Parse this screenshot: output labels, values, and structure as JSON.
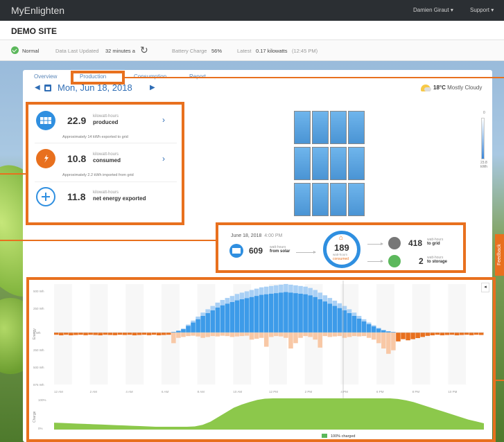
{
  "topbar": {
    "brand": "MyEnlighten",
    "user": "Damien Giraut",
    "support": "Support"
  },
  "site": {
    "title": "DEMO SITE"
  },
  "status": {
    "state": "Normal",
    "last_updated_label": "Data Last Updated",
    "last_updated_value": "32 minutes a",
    "battery_label": "Battery Charge",
    "battery_value": "56%",
    "latest_label": "Latest",
    "latest_value": "0.17 kilowatts",
    "latest_time": "(12:45 PM)"
  },
  "tabs": [
    "Overview",
    "Production",
    "Consumption",
    "Report"
  ],
  "date": "Mon, Jun 18, 2018",
  "weather": {
    "temp": "18°C",
    "condition": "Mostly Cloudy"
  },
  "metrics": [
    {
      "value": "22.9",
      "unit": "kilowatt-hours",
      "label": "produced",
      "sub": "Approximately 14 kWh exported to grid",
      "color": "#2f8fe0",
      "icon": "solar-panel-icon"
    },
    {
      "value": "10.8",
      "unit": "kilowatt-hours",
      "label": "consumed",
      "sub": "Approximately 2.2 kWh imported from grid",
      "color": "#e8701e",
      "icon": "plug-icon"
    },
    {
      "value": "11.8",
      "unit": "kilowatt-hours",
      "label": "net energy exported",
      "sub": "",
      "color": "#2f8fe0",
      "icon": "plus-icon"
    }
  ],
  "legend": {
    "top": "0",
    "bottom": "23.8",
    "unit": "kWh"
  },
  "flow": {
    "datetime": "June 18, 2018",
    "time": "4:00 PM",
    "solar_value": "609",
    "solar_unit": "watt-hours",
    "solar_label": "from solar",
    "consumed_value": "189",
    "consumed_unit": "watt-hours",
    "consumed_label": "consumed",
    "grid_value": "418",
    "grid_unit": "watt-hours",
    "grid_label": "to grid",
    "storage_value": "2",
    "storage_unit": "watt-hours",
    "storage_label": "to storage"
  },
  "feedback": "Feedback",
  "chart_data": [
    {
      "type": "bar",
      "ylabel": "Energy",
      "yticks": [
        "500 Wh",
        "250 Wh",
        "0 Wh",
        "250 Wh",
        "500 Wh",
        "875 Wh"
      ],
      "xticks": [
        "12 AM",
        "2 AM",
        "4 AM",
        "6 AM",
        "8 AM",
        "10 AM",
        "12 PM",
        "2 PM",
        "4 PM",
        "6 PM",
        "8 PM",
        "10 PM"
      ],
      "series": [
        {
          "name": "Produced",
          "color": "#3d9be9",
          "values": [
            0,
            0,
            0,
            0,
            0,
            0,
            0,
            0,
            0,
            0,
            0,
            0,
            0,
            0,
            0,
            0,
            0,
            0,
            0,
            0,
            0,
            0,
            0,
            0,
            5,
            15,
            30,
            60,
            90,
            120,
            150,
            175,
            200,
            225,
            245,
            260,
            275,
            290,
            300,
            310,
            320,
            330,
            340,
            345,
            350,
            355,
            360,
            365,
            360,
            355,
            350,
            345,
            335,
            320,
            300,
            280,
            260,
            240,
            220,
            200,
            175,
            150,
            125,
            100,
            75,
            55,
            35,
            20,
            10,
            5,
            0,
            0,
            0,
            0,
            0,
            0,
            0,
            0,
            0,
            0,
            0,
            0,
            0,
            0,
            0,
            0,
            0,
            0
          ]
        },
        {
          "name": "Consumed",
          "color": "#e8701e",
          "values": [
            -20,
            -25,
            -20,
            -25,
            -22,
            -20,
            -24,
            -20,
            -22,
            -25,
            -20,
            -22,
            -24,
            -20,
            -22,
            -20,
            -25,
            -22,
            -20,
            -24,
            -20,
            -25,
            -22,
            -20,
            -60,
            -30,
            -25,
            -20,
            -18,
            -22,
            -30,
            -25,
            -20,
            -22,
            -18,
            -20,
            -25,
            -22,
            -20,
            -18,
            -40,
            -35,
            -30,
            -80,
            -25,
            -20,
            -22,
            -30,
            -90,
            -60,
            -30,
            -20,
            -25,
            -40,
            -85,
            -20,
            -25,
            -22,
            -20,
            -30,
            -25,
            -20,
            -22,
            -20,
            -30,
            -40,
            -60,
            -90,
            -120,
            -100,
            -80,
            -60,
            -70,
            -60,
            -50,
            -40,
            -30,
            -25,
            -20,
            -25,
            -22,
            -20,
            -25,
            -22,
            -20,
            -24,
            -20,
            -22
          ]
        }
      ]
    },
    {
      "type": "area",
      "ylabel": "Charge",
      "yticks": [
        "100%",
        "0%"
      ],
      "series": [
        {
          "name": "Battery charge",
          "color": "#8cc84b",
          "values": [
            22,
            21,
            20,
            19,
            18,
            17,
            16,
            15,
            14,
            13,
            12,
            11,
            10,
            9,
            9,
            9,
            9,
            9,
            10,
            15,
            25,
            40,
            55,
            70,
            80,
            88,
            95,
            99,
            100,
            100,
            100,
            100,
            100,
            100,
            100,
            100,
            100,
            100,
            100,
            100,
            100,
            100,
            100,
            100,
            98,
            94,
            88,
            80,
            72,
            64,
            56,
            48,
            40,
            32,
            26,
            20
          ]
        }
      ],
      "legend": "100% charged"
    }
  ]
}
